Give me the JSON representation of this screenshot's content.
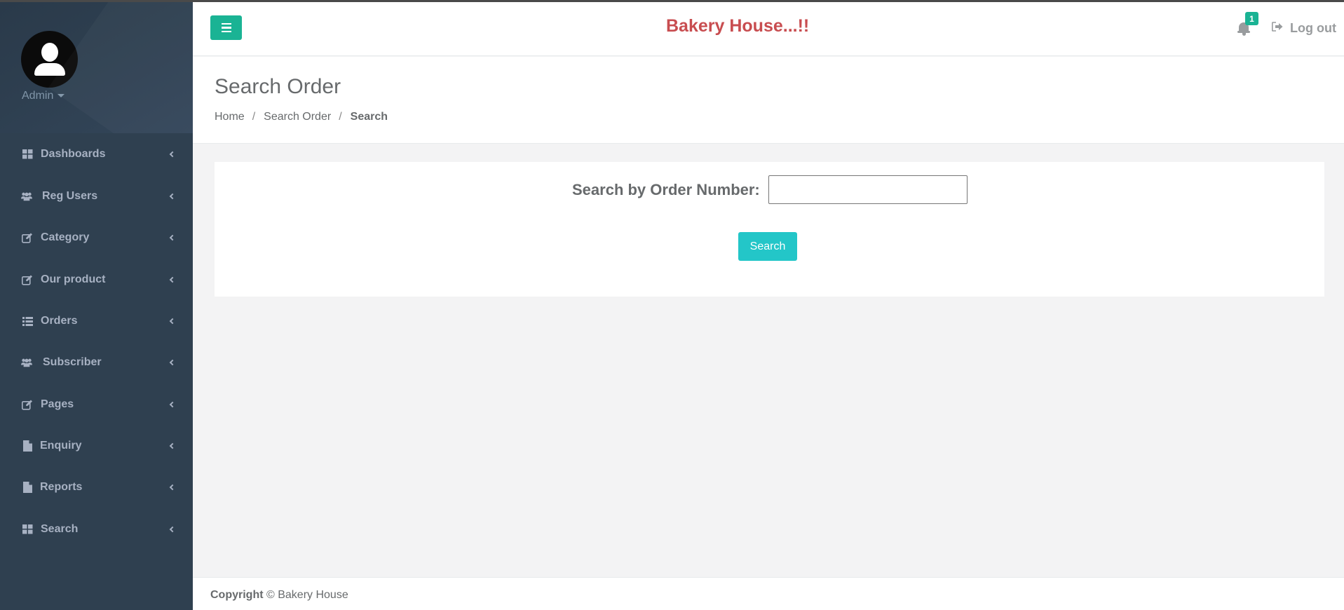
{
  "sidebar": {
    "profile_name": "Admin",
    "items": [
      {
        "label": "Dashboards",
        "icon": "grid-icon"
      },
      {
        "label": "Reg Users",
        "icon": "users-icon"
      },
      {
        "label": "Category",
        "icon": "edit-icon"
      },
      {
        "label": "Our product",
        "icon": "edit-icon"
      },
      {
        "label": "Orders",
        "icon": "list-icon"
      },
      {
        "label": "Subscriber",
        "icon": "users-icon"
      },
      {
        "label": "Pages",
        "icon": "edit-icon"
      },
      {
        "label": "Enquiry",
        "icon": "file-icon"
      },
      {
        "label": "Reports",
        "icon": "file-icon"
      },
      {
        "label": "Search",
        "icon": "grid-icon"
      }
    ]
  },
  "header": {
    "brand": "Bakery House...!!",
    "notification_count": "1",
    "logout_label": "Log out"
  },
  "page": {
    "title": "Search Order",
    "breadcrumb": [
      "Home",
      "Search Order",
      "Search"
    ]
  },
  "search_form": {
    "label": "Search by Order Number:",
    "input_value": "",
    "button_label": "Search"
  },
  "footer": {
    "copyright_label": "Copyright",
    "copyright_text": "© Bakery House"
  },
  "colors": {
    "sidebar_bg": "#2f4050",
    "accent_green": "#1ab394",
    "button_teal": "#23c6c8",
    "brand_red": "#c84d50",
    "content_bg": "#f3f3f4"
  }
}
